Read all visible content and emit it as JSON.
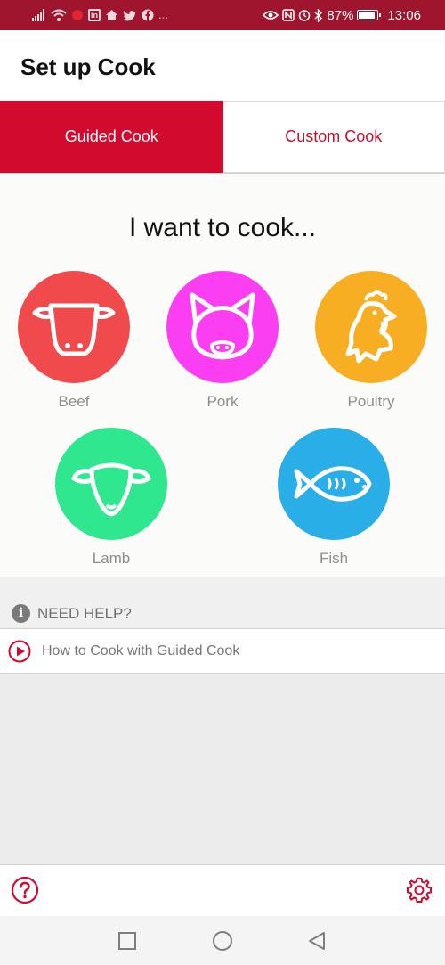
{
  "status_bar": {
    "time": "13:06",
    "battery_percent": "87%",
    "battery_level": 0.87,
    "left_icons": [
      "signal-icon",
      "wifi-icon",
      "notification-dot-icon",
      "linkedin-icon",
      "home-icon",
      "twitter-icon",
      "facebook-icon",
      "more-icon"
    ],
    "right_icons": [
      "eye-icon",
      "nfc-icon",
      "alarm-icon",
      "bluetooth-icon",
      "battery-icon"
    ],
    "more_label": "..."
  },
  "header": {
    "title": "Set up Cook"
  },
  "tabs": [
    {
      "label": "Guided Cook",
      "active": true
    },
    {
      "label": "Custom Cook",
      "active": false
    }
  ],
  "main": {
    "heading": "I want to cook...",
    "animals": [
      {
        "label": "Beef",
        "color": "#f04a4c",
        "icon": "cow-icon"
      },
      {
        "label": "Pork",
        "color": "#fb3ef1",
        "icon": "pig-icon"
      },
      {
        "label": "Poultry",
        "color": "#f8ae22",
        "icon": "chicken-icon"
      },
      {
        "label": "Lamb",
        "color": "#2ee78e",
        "icon": "sheep-icon"
      },
      {
        "label": "Fish",
        "color": "#2aaee8",
        "icon": "fish-icon"
      }
    ]
  },
  "help": {
    "title": "NEED HELP?",
    "info_glyph": "i",
    "link": "How to Cook with Guided Cook"
  },
  "colors": {
    "status_bar": "#a0152e",
    "accent": "#d10a2e",
    "custom_tab_text": "#c8102e"
  }
}
